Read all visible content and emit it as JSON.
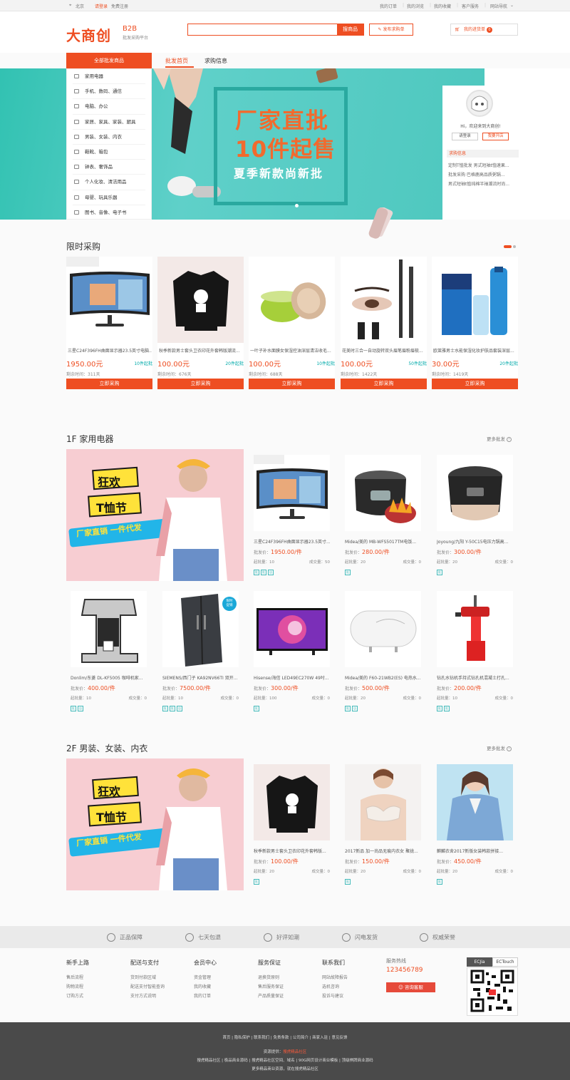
{
  "topbar": {
    "location": "北京",
    "login": "请登录",
    "register": "免费注册",
    "links": [
      "我的订单",
      "我的浏览",
      "我的收藏",
      "客户服务",
      "网站导航"
    ]
  },
  "header": {
    "logo": "大商创",
    "logo_tag": "B2B",
    "logo_sub": "批发采购平台",
    "search_placeholder": "",
    "search_button": "搜商品",
    "publish_button": "发布求购单",
    "cart_label": "我的进货单",
    "cart_count": "0"
  },
  "nav": {
    "all_categories": "全部批发商品",
    "tabs": [
      "批发首页",
      "求购信息"
    ]
  },
  "categories": [
    "家用电器",
    "手机、数码、通信",
    "电脑、办公",
    "家居、家具、家装、厨具",
    "男装、女装、内衣",
    "鞋靴、箱包",
    "钟表、奢饰品",
    "个人化妆、清洁用品",
    "母婴、玩具乐器",
    "图书、音像、电子书"
  ],
  "banner": {
    "line1": "厂家直批",
    "line2": "10件起售",
    "line3": "夏季新款尚新批"
  },
  "user_panel": {
    "welcome": "Hi，欢迎来到大商创!",
    "login": "请登录",
    "open_store": "我要开店",
    "purchase_title": "求购信息",
    "purchase_items": [
      "定制T恤批发 男式短袖t恤速果...",
      "批发采购 巴格鹿高品质粥锅...",
      "男式短袖t恤纯棉半袖潮流时尚..."
    ]
  },
  "flash": {
    "title": "限时采购",
    "items": [
      {
        "name": "三星C24F396FH曲面显示器23.5英寸电脑...",
        "price": "1950.00元",
        "min": "10件起批",
        "left": "剩余时间：311天",
        "buy": "立即采购"
      },
      {
        "name": "秋季新款男士套头卫衣印花外套韩版潮流...",
        "price": "100.00元",
        "min": "20件起批",
        "left": "剩余时间：676天",
        "buy": "立即采购"
      },
      {
        "name": "一叶子补水面膜女保湿控油深层清洁收毛...",
        "price": "100.00元",
        "min": "10件起批",
        "left": "剩余时间：688天",
        "buy": "立即采购"
      },
      {
        "name": "花美时三合一自动旋转双头眉笔眉粉眉梳...",
        "price": "100.00元",
        "min": "50件起批",
        "left": "剩余时间：1422天",
        "buy": "立即采购"
      },
      {
        "name": "欧莱雅男士水能保湿化妆护肤品套装深层...",
        "price": "30.00元",
        "min": "20件起批",
        "left": "剩余时间：1419天",
        "buy": "立即采购"
      }
    ]
  },
  "floor1": {
    "title": "1F 家用电器",
    "more": "更多批发",
    "promo": {
      "line1": "狂欢",
      "line2": "T恤节",
      "slogan": "厂家直销 一件代发"
    },
    "items": [
      {
        "name": "三星C24F396FH曲面显示器23.5英寸...",
        "price_label": "批发价：",
        "price": "1950.00/件",
        "min": "起批量：10",
        "sold": "成交量：50"
      },
      {
        "name": "Midea/美的 MB-WFS5017TM电饭...",
        "price_label": "批发价：",
        "price": "280.00/件",
        "min": "起批量：20",
        "sold": "成交量：0"
      },
      {
        "name": "Joyoung/九阳 Y-50C15电压力锅高...",
        "price_label": "批发价：",
        "price": "300.00/件",
        "min": "起批量：20",
        "sold": "成交量：0"
      },
      {
        "name": "Donlim/东菱 DL-KF5005 咖啡机家...",
        "price_label": "批发价：",
        "price": "400.00/件",
        "min": "起批量：10",
        "sold": "成交量：0"
      },
      {
        "name": "SIEMENS/西门子 KA92NV66TI 双开...",
        "price_label": "批发价：",
        "price": "7500.00/件",
        "min": "起批量：10",
        "sold": "成交量：0"
      },
      {
        "name": "Hisense/海信 LED49EC270W 49吋...",
        "price_label": "批发价：",
        "price": "300.00/件",
        "min": "起批量：100",
        "sold": "成交量：0"
      },
      {
        "name": "Midea/美的 F60-21WB2(ES) 电热水...",
        "price_label": "批发价：",
        "price": "500.00/件",
        "min": "起批量：20",
        "sold": "成交量：0"
      },
      {
        "name": "钻孔水钻机手持式钻孔机混凝土打孔...",
        "price_label": "批发价：",
        "price": "200.00/件",
        "min": "起批量：10",
        "sold": "成交量：0"
      }
    ],
    "fridge_badge": "限时\n促销"
  },
  "floor2": {
    "title": "2F 男装、女装、内衣",
    "more": "更多批发",
    "promo": {
      "line1": "狂欢",
      "line2": "T恤节",
      "slogan": "厂家直销 一件代发"
    },
    "items": [
      {
        "name": "秋季新款男士套头卫衣印花外套韩版...",
        "price_label": "批发价：",
        "price": "100.00/件",
        "min": "起批量：20",
        "sold": "成交量：0"
      },
      {
        "name": "2017新品 加一尚品无痕内衣女 聚拢...",
        "price_label": "批发价：",
        "price": "150.00/件",
        "min": "起批量：20",
        "sold": "成交量：0"
      },
      {
        "name": "麒麟衣舍2017新版女装韩款拼接...",
        "price_label": "批发价：",
        "price": "450.00/件",
        "min": "起批量：20",
        "sold": "成交量：0"
      }
    ]
  },
  "services": [
    "正品保障",
    "七天包退",
    "好评如潮",
    "闪电发货",
    "权威荣誉"
  ],
  "footer_cols": [
    {
      "title": "新手上路",
      "links": [
        "售后流程",
        "购物流程",
        "订购方式"
      ]
    },
    {
      "title": "配送与支付",
      "links": [
        "货到付款区域",
        "配送支付智能查询",
        "支付方式说明"
      ]
    },
    {
      "title": "会员中心",
      "links": [
        "资金管理",
        "我的收藏",
        "我的订单"
      ]
    },
    {
      "title": "服务保证",
      "links": [
        "退换货原则",
        "售后服务保证",
        "产品质量保证"
      ]
    },
    {
      "title": "联系我们",
      "links": [
        "网站故障报告",
        "选机咨询",
        "投诉与建议"
      ]
    }
  ],
  "hotline": {
    "label": "服务热线",
    "number": "123456789",
    "chat": "咨询客服"
  },
  "qr_tabs": [
    "ECJia",
    "ECTouch"
  ],
  "bottom": {
    "links": "首页 | 隐私保护 | 联系我们 | 免责条款 | 公司简介 | 商家入驻 | 意见反馈",
    "source_label": "资源提供：",
    "source_name": "搜虎精品社区",
    "line3": "搜虎精品社区 | 极品商业源码 | 搜虎精品社区空间、域名 | 90G网页设计商业模板 | 顶级棋牌商业源码",
    "line4": "更多精品商业资源，就在搜虎精品社区"
  },
  "colors": {
    "brand": "#ee4e22",
    "teal": "#4dc7be",
    "footer_dark": "#4a4a4a"
  }
}
